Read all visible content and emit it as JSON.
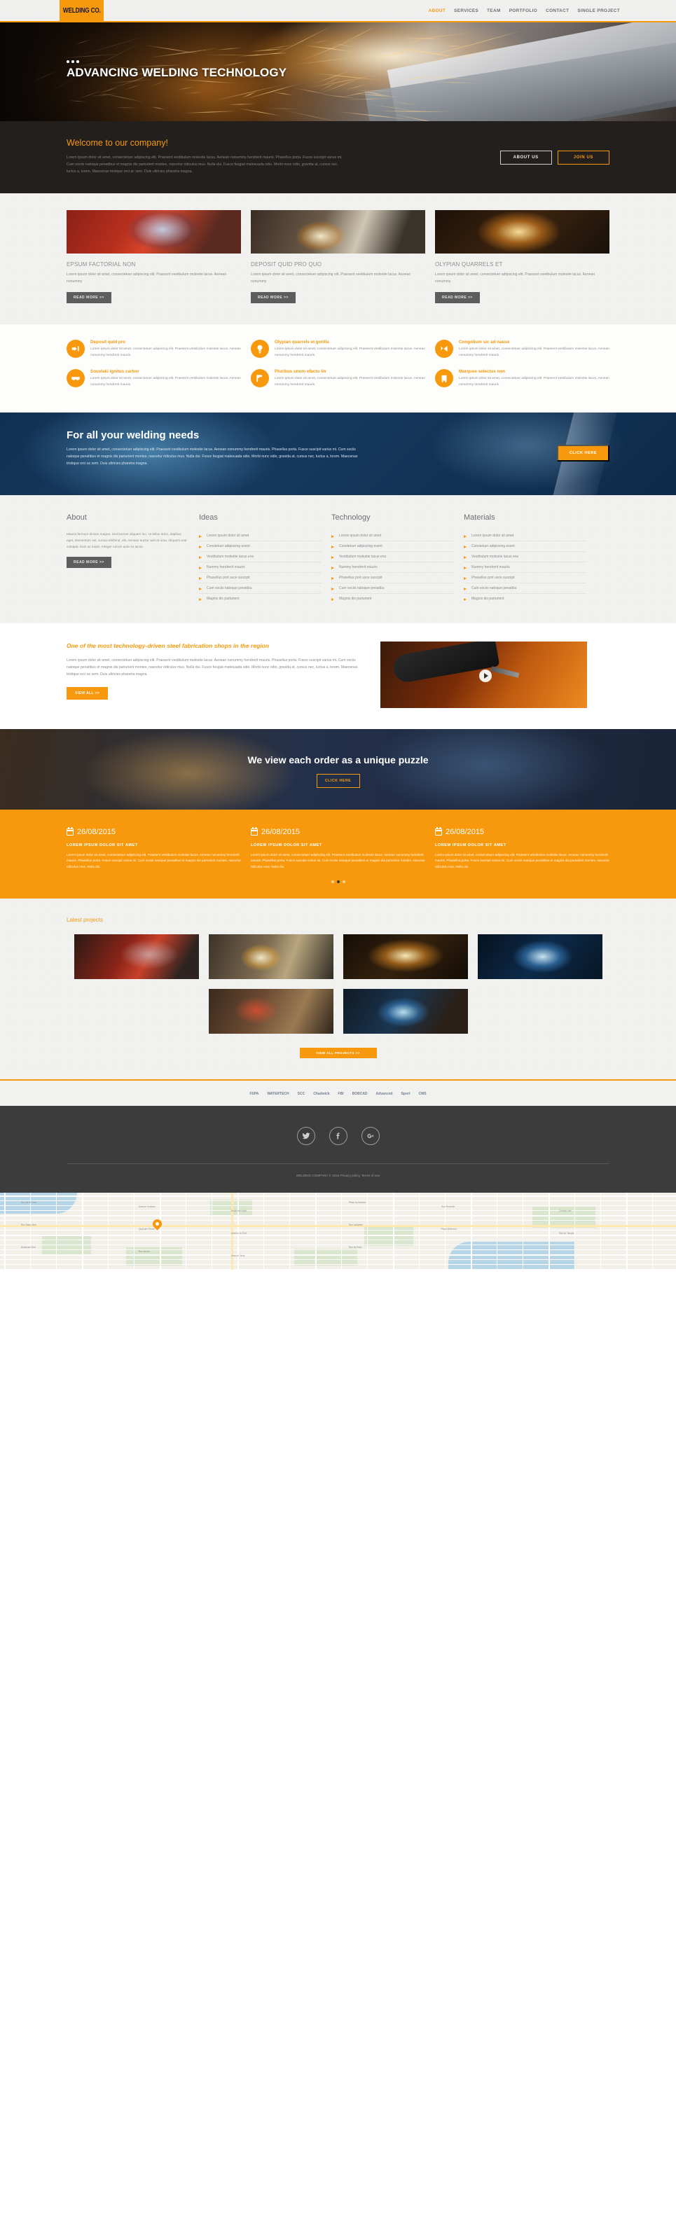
{
  "header": {
    "logo": "WELDING CO.",
    "nav": [
      {
        "label": "ABOUT",
        "active": true
      },
      {
        "label": "SERVICES",
        "active": false
      },
      {
        "label": "TEAM",
        "active": false
      },
      {
        "label": "PORTFOLIO",
        "active": false
      },
      {
        "label": "CONTACT",
        "active": false
      },
      {
        "label": "SINGLE PROJECT",
        "active": false
      }
    ]
  },
  "hero": {
    "title": "ADVANCING WELDING TECHNOLOGY"
  },
  "welcome": {
    "title": "Welcome to our company!",
    "text": "Lorem ipsum dolor sit amet, consectetuer adipiscing elit. Praesent vestibulum molestie lacus. Aenean nonummy hendrerit mauris. Phasellus porta. Fusce suscipit varius mi. Cum sociis natoque penatibus et magnis dis parturient montes, nascetur ridiculus mus. Nulla dui. Fusce feugiat malesuada odio. Morbi nunc odio, gravida at, cursus nec, luctus a, lorem. Maecenas tristique orci ac sem. Duis ultricies pharetra magna.",
    "about_button": "ABOUT US",
    "join_button": "JOIN US"
  },
  "cards": [
    {
      "title": "EPSUM FACTORIAL NON",
      "text": "Lorem ipsum dolor sit amet, consectetuer adipiscing elit. Praesent vestibulum molestie lacus. Aenean nonummy",
      "button": "READ MORE  >>"
    },
    {
      "title": "DEPOSIT QUID PRO QUO",
      "text": "Lorem ipsum dolor sit amet, consectetuer adipiscing elit. Praesent vestibulum molestie lacus. Aenean nonummy",
      "button": "READ MORE  >>"
    },
    {
      "title": "OLYPIAN QUARRELS ET",
      "text": "Lorem ipsum dolor sit amet, consectetuer adipiscing elit. Praesent vestibulum molestie lacus. Aenean nonummy",
      "button": "READ MORE  >>"
    }
  ],
  "features": [
    {
      "title": "Deposit quid pro",
      "text": "Lorem ipsum dolor sit amet, consectetuer adipiscing elit. Praesent vestibulum molestie lacus. Aenean nonummy hendrerit mauris.",
      "icon": "plug-icon"
    },
    {
      "title": "Olypian quarrels et gorilla",
      "text": "Lorem ipsum dolor sit amet, consectetuer adipiscing elit. Praesent vestibulum molestie lacus. Aenean nonummy hendrerit mauris.",
      "icon": "bulb-icon"
    },
    {
      "title": "Congolium sic ad nause",
      "text": "Lorem ipsum dolor sit amet, consectetuer adipiscing elit. Praesent vestibulum molestie lacus. Aenean nonummy hendrerit mauris.",
      "icon": "spark-icon"
    },
    {
      "title": "Souvlaki ignitus carbor",
      "text": "Lorem ipsum dolor sit amet, consectetuer adipiscing elit. Praesent vestibulum molestie lacus. Aenean nonummy hendrerit mauris.",
      "icon": "goggles-icon"
    },
    {
      "title": "Pluribus unum efacto lin",
      "text": "Lorem ipsum dolor sit amet, consectetuer adipiscing elit. Praesent vestibulum molestie lacus. Aenean nonummy hendrerit mauris.",
      "icon": "weld-gun-icon"
    },
    {
      "title": "Marquee selectus non",
      "text": "Lorem ipsum dolor sit amet, consectetuer adipiscing elit. Praesent vestibulum molestie lacus. Aenean nonummy hendrerit mauris.",
      "icon": "welder-machine-icon"
    }
  ],
  "needs": {
    "title": "For all your welding needs",
    "text": "Lorem ipsum dolor sit amet, consectetuer adipiscing elit. Praesent vestibulum molestie lacus. Aenean nonummy hendrerit mauris. Phasellus porta. Fusce suscipit varius mi. Cum sociis natoque penatibus et magnis dis parturient montes, nascetur ridiculus mus. Nulla dui. Fusce feugiat malesuada odio. Morbi nunc odio, gravida at, cursus nec, luctus a, lorem. Maecenas tristique orci ac sem. Duis ultricies pharetra magna.",
    "button": "CLICK HERE"
  },
  "fourcols": {
    "about": {
      "title": "About",
      "text": "Mauris fermum dictum magna. Sed laoreet aliquam leo. Ut tellus dolor, dapibus eget, elementum vel, cursus eleifend, elit. Aenean auctor wisi et urna. Aliquam erat volutpat. Duis ac turpis. Integer rutrum ante eu lacus.",
      "button": "READ MORE  >>"
    },
    "lists": [
      {
        "title": "Ideas",
        "items": [
          "Lorem ipsum dolor sit amet",
          "Constetuer adipiscing esent",
          "Vestibulum molestie lacus eno",
          "Nummy hendrerit mauris",
          "Phasellus port usce suscipit",
          "Cum sociis natoque penatibu",
          "Magnis dis parturient"
        ]
      },
      {
        "title": "Technology",
        "items": [
          "Lorem ipsum dolor sit amet",
          "Constetuer adipiscing esent",
          "Vestibulum molestie lacus eno",
          "Nummy hendrerit mauris",
          "Phasellus port usce suscipit",
          "Cum sociis natoque penatibu",
          "Magnis dis parturient"
        ]
      },
      {
        "title": "Materials",
        "items": [
          "Lorem ipsum dolor sit amet",
          "Constetuer adipiscing esent",
          "Vestibulum molestie lacus eno",
          "Nummy hendrerit mauris",
          "Phasellus port usce suscipit",
          "Cum sociis natoque penatibu",
          "Magnis dis parturient"
        ]
      }
    ]
  },
  "promo": {
    "title": "One of the most technology-driven steel fabrication shops in the region",
    "text": "Lorem ipsum dolor sit amet, consectetuer adipiscing elit. Praesent vestibulum molestie lacus. Aenean nonummy hendrerit mauris. Phasellus porta. Fusce suscipit varius mi. Cum sociis natoque penatibus et magnis dis parturient montes, nascetur ridiculus mus. Nulla dui. Fusce feugiat malesuada odio. Morbi nunc odio, gravida at, cursus nec, luctus a, lorem. Maecenas tristique orci ac sem. Duis ultricies pharetra magna.",
    "button": "VIEW ALL  >>",
    "play": "play-icon"
  },
  "puzzle": {
    "title": "We view each order as a unique puzzle",
    "button": "CLICK HERE"
  },
  "news": {
    "items": [
      {
        "date": "26/08/2015",
        "title": "LOREM IPSUM DOLOR SIT AMET",
        "text": "Lorem ipsum dolor sit amet, consectetuer adipiscing elit. Praesent vestibulum molestie lacus. Aenean nonummy hendrerit mauris. Phasellus porta. Fusce suscipit varius mi. Cum sociis natoque penatibus et magnis dis parturient montes, nascetur ridiculus mus. Nulla dui."
      },
      {
        "date": "26/08/2015",
        "title": "LOREM IPSUM DOLOR SIT AMET",
        "text": "Lorem ipsum dolor sit amet, consectetuer adipiscing elit. Praesent vestibulum molestie lacus. Aenean nonummy hendrerit mauris. Phasellus porta. Fusce suscipit varius mi. Cum sociis natoque penatibus et magnis dis parturient montes, nascetur ridiculus mus. Nulla dui."
      },
      {
        "date": "26/08/2015",
        "title": "LOREM IPSUM DOLOR SIT AMET",
        "text": "Lorem ipsum dolor sit amet, consectetuer adipiscing elit. Praesent vestibulum molestie lacus. Aenean nonummy hendrerit mauris. Phasellus porta. Fusce suscipit varius mi. Cum sociis natoque penatibus et magnis dis parturient montes, nascetur ridiculus mus. Nulla dui."
      }
    ],
    "pager_active_index": 1
  },
  "projects": {
    "title": "Latest projects",
    "button": "VIEW ALL PROJECTS  >>"
  },
  "partners": [
    {
      "label": "FSPA"
    },
    {
      "label": "WATERTECH"
    },
    {
      "label": "SCC"
    },
    {
      "label": "Chadwick"
    },
    {
      "label": "FBI"
    },
    {
      "label": "BOBCAD"
    },
    {
      "label": "Advanced"
    },
    {
      "label": "Sport"
    },
    {
      "label": "CMS"
    }
  ],
  "footer": {
    "social": [
      {
        "name": "twitter-icon",
        "glyph": "t"
      },
      {
        "name": "facebook-icon",
        "glyph": "f"
      },
      {
        "name": "google-plus-icon",
        "glyph": "g+"
      }
    ],
    "copyright": "WELDING COMPANY © 2015",
    "privacy": "Privacy policy",
    "terms": "Terms of use"
  },
  "map": {
    "pin": "location-pin-icon",
    "labels": [
      "Rue de la Gare",
      "Avenue Centrale",
      "Boulevard Nord",
      "Place du Marche",
      "Rue Rochelle",
      "Chemin Vert",
      "Rue Saint-Jean",
      "Quai des Fleurs",
      "Avenue du Port",
      "Rue Lafayette",
      "Place Bellecour",
      "Rue du Temple",
      "Boulevard Sud",
      "Rue Neuve",
      "Avenue Victor",
      "Rue de Paris"
    ]
  },
  "colors": {
    "accent": "#f8990d",
    "dark": "#221f1d",
    "footer": "#3c3c3c",
    "paper": "#f1f1ef"
  }
}
